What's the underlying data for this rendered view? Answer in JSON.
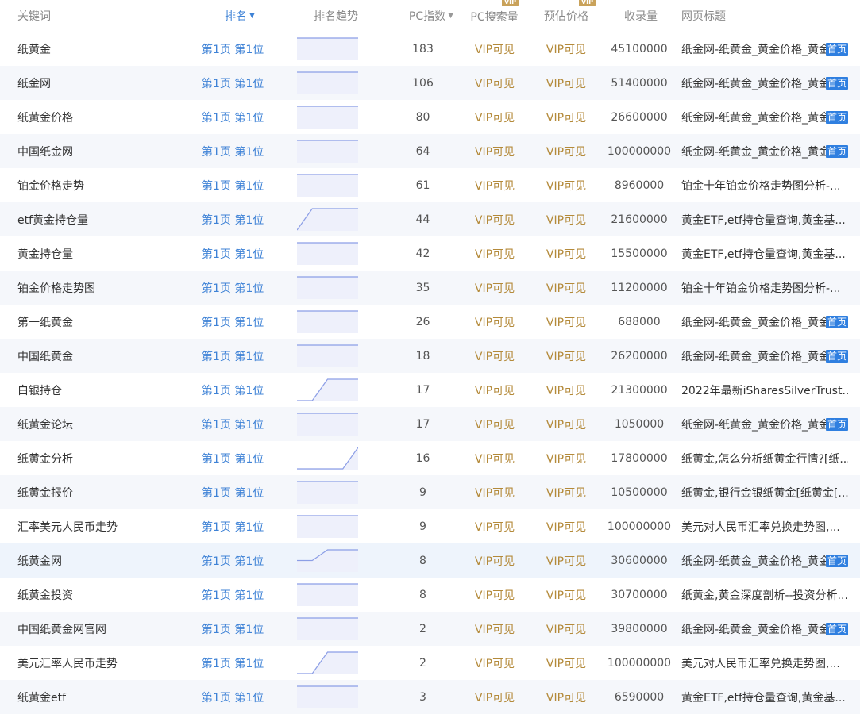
{
  "header": {
    "keyword": "关键词",
    "rank": "排名",
    "trend": "排名趋势",
    "pc_index": "PC指数",
    "pc_search": "PC搜索量",
    "est_price": "预估价格",
    "included": "收录量",
    "page_title": "网页标题",
    "vip_badge": "VIP"
  },
  "colors": {
    "link": "#3e82d6",
    "vip_text": "#b48a3a",
    "home_badge": "#2f7fe0",
    "trend_line": "#8c9ee6",
    "trend_fill": "#eef0fb"
  },
  "rows": [
    {
      "keyword": "纸黄金",
      "rank": "第1页 第1位",
      "trend": [
        0,
        0,
        0,
        0,
        0
      ],
      "pc": "183",
      "search": "VIP可见",
      "price": "VIP可见",
      "included": "45100000",
      "title": "纸金网-纸黄金_黄金价格_黄金",
      "home": "首页"
    },
    {
      "keyword": "纸金网",
      "rank": "第1页 第1位",
      "trend": [
        0,
        0,
        0,
        0,
        0
      ],
      "pc": "106",
      "search": "VIP可见",
      "price": "VIP可见",
      "included": "51400000",
      "title": "纸金网-纸黄金_黄金价格_黄金",
      "home": "首页"
    },
    {
      "keyword": "纸黄金价格",
      "rank": "第1页 第1位",
      "trend": [
        0,
        0,
        0,
        0,
        0
      ],
      "pc": "80",
      "search": "VIP可见",
      "price": "VIP可见",
      "included": "26600000",
      "title": "纸金网-纸黄金_黄金价格_黄金",
      "home": "首页"
    },
    {
      "keyword": "中国纸金网",
      "rank": "第1页 第1位",
      "trend": [
        0,
        0,
        0,
        0,
        0
      ],
      "pc": "64",
      "search": "VIP可见",
      "price": "VIP可见",
      "included": "100000000",
      "title": "纸金网-纸黄金_黄金价格_黄金",
      "home": "首页"
    },
    {
      "keyword": "铂金价格走势",
      "rank": "第1页 第1位",
      "trend": [
        0,
        0,
        0,
        0,
        0
      ],
      "pc": "61",
      "search": "VIP可见",
      "price": "VIP可见",
      "included": "8960000",
      "title": "铂金十年铂金价格走势图分析-...",
      "home": ""
    },
    {
      "keyword": "etf黄金持仓量",
      "rank": "第1页 第1位",
      "trend": [
        1,
        0,
        0,
        0,
        0
      ],
      "pc": "44",
      "search": "VIP可见",
      "price": "VIP可见",
      "included": "21600000",
      "title": "黄金ETF,etf持仓量查询,黄金基...",
      "home": ""
    },
    {
      "keyword": "黄金持仓量",
      "rank": "第1页 第1位",
      "trend": [
        0,
        0,
        0,
        0,
        0
      ],
      "pc": "42",
      "search": "VIP可见",
      "price": "VIP可见",
      "included": "15500000",
      "title": "黄金ETF,etf持仓量查询,黄金基...",
      "home": ""
    },
    {
      "keyword": "铂金价格走势图",
      "rank": "第1页 第1位",
      "trend": [
        0,
        0,
        0,
        0,
        0
      ],
      "pc": "35",
      "search": "VIP可见",
      "price": "VIP可见",
      "included": "11200000",
      "title": "铂金十年铂金价格走势图分析-...",
      "home": ""
    },
    {
      "keyword": "第一纸黄金",
      "rank": "第1页 第1位",
      "trend": [
        0,
        0,
        0,
        0,
        0
      ],
      "pc": "26",
      "search": "VIP可见",
      "price": "VIP可见",
      "included": "688000",
      "title": "纸金网-纸黄金_黄金价格_黄金",
      "home": "首页"
    },
    {
      "keyword": "中国纸黄金",
      "rank": "第1页 第1位",
      "trend": [
        0,
        0,
        0,
        0,
        0
      ],
      "pc": "18",
      "search": "VIP可见",
      "price": "VIP可见",
      "included": "26200000",
      "title": "纸金网-纸黄金_黄金价格_黄金",
      "home": "首页"
    },
    {
      "keyword": "白银持仓",
      "rank": "第1页 第1位",
      "trend": [
        1,
        1,
        0,
        0,
        0
      ],
      "pc": "17",
      "search": "VIP可见",
      "price": "VIP可见",
      "included": "21300000",
      "title": "2022年最新iSharesSilverTrust...",
      "home": ""
    },
    {
      "keyword": "纸黄金论坛",
      "rank": "第1页 第1位",
      "trend": [
        0,
        0,
        0,
        0,
        0
      ],
      "pc": "17",
      "search": "VIP可见",
      "price": "VIP可见",
      "included": "1050000",
      "title": "纸金网-纸黄金_黄金价格_黄金",
      "home": "首页"
    },
    {
      "keyword": "纸黄金分析",
      "rank": "第1页 第1位",
      "trend": [
        1,
        1,
        1,
        1,
        0
      ],
      "pc": "16",
      "search": "VIP可见",
      "price": "VIP可见",
      "included": "17800000",
      "title": "纸黄金,怎么分析纸黄金行情?[纸...",
      "home": ""
    },
    {
      "keyword": "纸黄金报价",
      "rank": "第1页 第1位",
      "trend": [
        0,
        0,
        0,
        0,
        0
      ],
      "pc": "9",
      "search": "VIP可见",
      "price": "VIP可见",
      "included": "10500000",
      "title": "纸黄金,银行金银纸黄金[纸黄金[...",
      "home": ""
    },
    {
      "keyword": "汇率美元人民币走势",
      "rank": "第1页 第1位",
      "trend": [
        0,
        0,
        0,
        0,
        0
      ],
      "pc": "9",
      "search": "VIP可见",
      "price": "VIP可见",
      "included": "100000000",
      "title": "美元对人民币汇率兑换走势图,...",
      "home": ""
    },
    {
      "keyword": "纸黄金网",
      "rank": "第1页 第1位",
      "trend": [
        0.5,
        0.5,
        0,
        0,
        0
      ],
      "pc": "8",
      "search": "VIP可见",
      "price": "VIP可见",
      "included": "30600000",
      "title": "纸金网-纸黄金_黄金价格_黄金",
      "home": "首页"
    },
    {
      "keyword": "纸黄金投资",
      "rank": "第1页 第1位",
      "trend": [
        0,
        0,
        0,
        0,
        0
      ],
      "pc": "8",
      "search": "VIP可见",
      "price": "VIP可见",
      "included": "30700000",
      "title": "纸黄金,黄金深度剖析--投资分析...",
      "home": ""
    },
    {
      "keyword": "中国纸黄金网官网",
      "rank": "第1页 第1位",
      "trend": [
        0,
        0,
        0,
        0,
        0
      ],
      "pc": "2",
      "search": "VIP可见",
      "price": "VIP可见",
      "included": "39800000",
      "title": "纸金网-纸黄金_黄金价格_黄金",
      "home": "首页"
    },
    {
      "keyword": "美元汇率人民币走势",
      "rank": "第1页 第1位",
      "trend": [
        1,
        1,
        0,
        0,
        0
      ],
      "pc": "2",
      "search": "VIP可见",
      "price": "VIP可见",
      "included": "100000000",
      "title": "美元对人民币汇率兑换走势图,...",
      "home": ""
    },
    {
      "keyword": "纸黄金etf",
      "rank": "第1页 第1位",
      "trend": [
        0,
        0,
        0,
        0,
        0
      ],
      "pc": "3",
      "search": "VIP可见",
      "price": "VIP可见",
      "included": "6590000",
      "title": "黄金ETF,etf持仓量查询,黄金基...",
      "home": ""
    }
  ]
}
